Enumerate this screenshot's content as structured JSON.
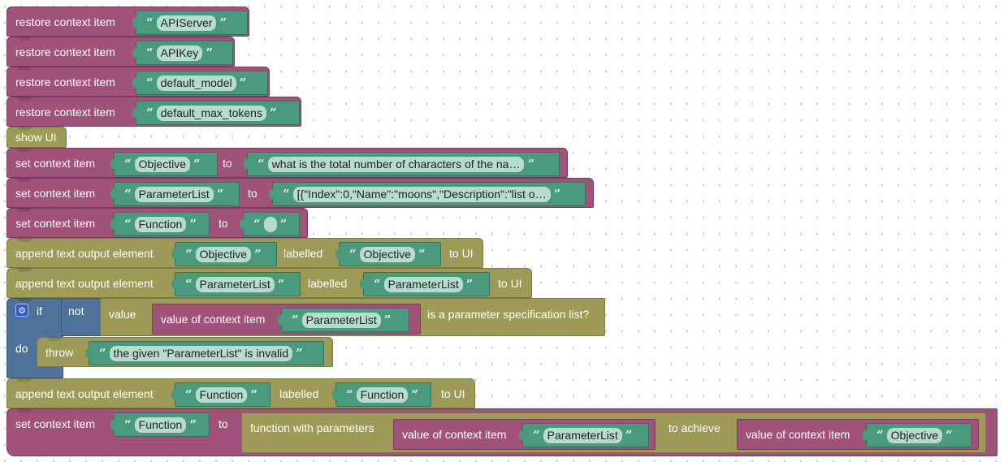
{
  "colors": {
    "context_block": "#a0527a",
    "ui_block": "#9e9a58",
    "logic_block": "#4e7299",
    "text_block": "#4a9a7e",
    "workspace_background": "#ffffff"
  },
  "blocks": {
    "restore1": {
      "label": "restore context item",
      "arg": "APIServer"
    },
    "restore2": {
      "label": "restore context item",
      "arg": "APIKey"
    },
    "restore3": {
      "label": "restore context item",
      "arg": "default_model"
    },
    "restore4": {
      "label": "restore context item",
      "arg": "default_max_tokens"
    },
    "show_ui": {
      "label": "show UI"
    },
    "set1": {
      "label": "set context item",
      "key": "Objective",
      "to": "to",
      "value": "what is the total number of characters of the na…"
    },
    "set2": {
      "label": "set context item",
      "key": "ParameterList",
      "to": "to",
      "value": "[{\"Index\":0,\"Name\":\"moons\",\"Description\":\"list o…"
    },
    "set3": {
      "label": "set context item",
      "key": "Function",
      "to": "to",
      "value": ""
    },
    "append1": {
      "label": "append text output element",
      "element": "Objective",
      "labelled": "labelled",
      "label_value": "Objective",
      "to_ui": "to UI"
    },
    "append2": {
      "label": "append text output element",
      "element": "ParameterList",
      "labelled": "labelled",
      "label_value": "ParameterList",
      "to_ui": "to UI"
    },
    "if_block": {
      "if": "if",
      "not": "not",
      "value": "value",
      "value_of": "value of context item",
      "key": "ParameterList",
      "check": "is a parameter specification list?",
      "do": "do",
      "throw": "throw",
      "message": "the given \"ParameterList\" is invalid",
      "gear_icon": "⚙"
    },
    "append3": {
      "label": "append text output element",
      "element": "Function",
      "labelled": "labelled",
      "label_value": "Function",
      "to_ui": "to UI"
    },
    "set4": {
      "label": "set context item",
      "key": "Function",
      "to": "to",
      "fn_label": "function with parameters",
      "value_of_1": "value of context item",
      "param_key": "ParameterList",
      "to_achieve": "to achieve",
      "value_of_2": "value of context item",
      "objective_key": "Objective"
    }
  },
  "glyphs": {
    "open_quote": "“",
    "close_quote": "”"
  }
}
